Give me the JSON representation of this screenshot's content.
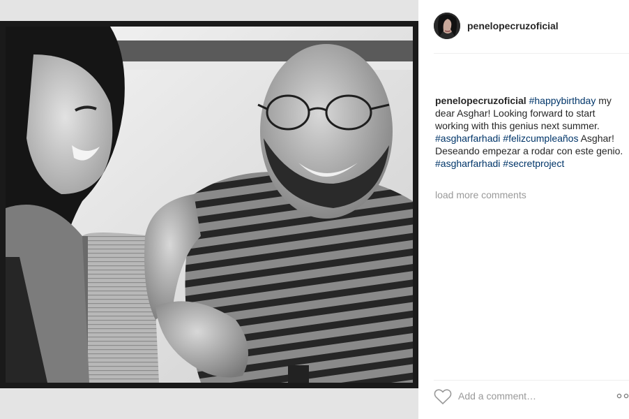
{
  "post": {
    "username": "penelopecruzoficial",
    "avatar_icon": "profile-photo",
    "caption": [
      {
        "text": "penelopecruzoficial",
        "kind": "username"
      },
      {
        "text": " ",
        "kind": "plain"
      },
      {
        "text": "#happybirthday",
        "kind": "hashtag"
      },
      {
        "text": " my dear Asghar! Looking forward to start working with this genius next summer. ",
        "kind": "plain"
      },
      {
        "text": "#asgharfarhadi",
        "kind": "hashtag"
      },
      {
        "text": " ",
        "kind": "plain"
      },
      {
        "text": "#felizcumpleaños",
        "kind": "hashtag"
      },
      {
        "text": " Asghar! Deseando empezar a rodar con este genio. ",
        "kind": "plain"
      },
      {
        "text": "#asgharfarhadi",
        "kind": "hashtag"
      },
      {
        "text": " ",
        "kind": "plain"
      },
      {
        "text": "#secretproject",
        "kind": "hashtag"
      }
    ],
    "load_more": "load more comments",
    "comment_placeholder": "Add a comment…"
  },
  "icons": {
    "like": "heart-icon",
    "more": "more-options-icon"
  },
  "colors": {
    "hashtag": "#003569",
    "muted": "#999999",
    "text": "#262626",
    "media_background": "#e4e4e4",
    "photo_border": "#1a1a1a"
  }
}
